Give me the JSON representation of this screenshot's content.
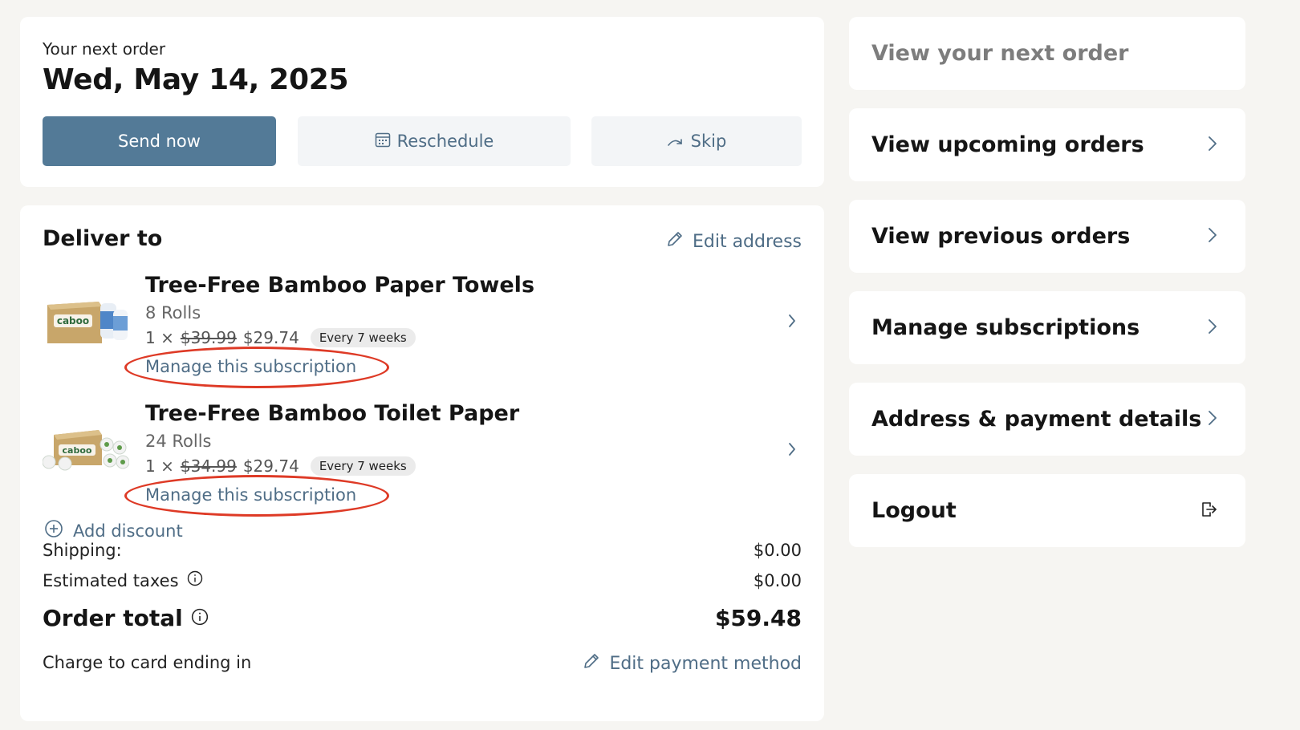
{
  "next_order": {
    "eyebrow": "Your next order",
    "date": "Wed, May 14, 2025",
    "send_now_label": "Send now",
    "reschedule_label": "Reschedule",
    "skip_label": "Skip"
  },
  "deliver": {
    "title": "Deliver to",
    "edit_address_label": "Edit address",
    "products": [
      {
        "name": "Tree-Free Bamboo Paper Towels",
        "variant": "8 Rolls",
        "quantity": "1 ×",
        "original_price": "$39.99",
        "price": "$29.74",
        "frequency": "Every 7 weeks",
        "manage_label": "Manage this subscription"
      },
      {
        "name": "Tree-Free Bamboo Toilet Paper",
        "variant": "24 Rolls",
        "quantity": "1 ×",
        "original_price": "$34.99",
        "price": "$29.74",
        "frequency": "Every 7 weeks",
        "manage_label": "Manage this subscription"
      }
    ],
    "add_discount_label": "Add discount",
    "shipping_label": "Shipping:",
    "shipping_value": "$0.00",
    "taxes_label": "Estimated taxes",
    "taxes_value": "$0.00",
    "total_label": "Order total",
    "total_value": "$59.48",
    "charge_label": "Charge to card ending in",
    "edit_payment_label": "Edit payment method",
    "thumb_brand": "caboo"
  },
  "nav": {
    "items": [
      {
        "label": "View your next order",
        "icon": "none"
      },
      {
        "label": "View upcoming orders",
        "icon": "chevron-right-icon"
      },
      {
        "label": "View previous orders",
        "icon": "chevron-right-icon"
      },
      {
        "label": "Manage subscriptions",
        "icon": "chevron-right-icon"
      },
      {
        "label": "Address & payment details",
        "icon": "chevron-right-icon"
      },
      {
        "label": "Logout",
        "icon": "logout-icon"
      }
    ]
  },
  "colors": {
    "accent": "#537a97",
    "link": "#4f6d86",
    "background": "#f6f5f2",
    "annotation": "#de3a26"
  }
}
